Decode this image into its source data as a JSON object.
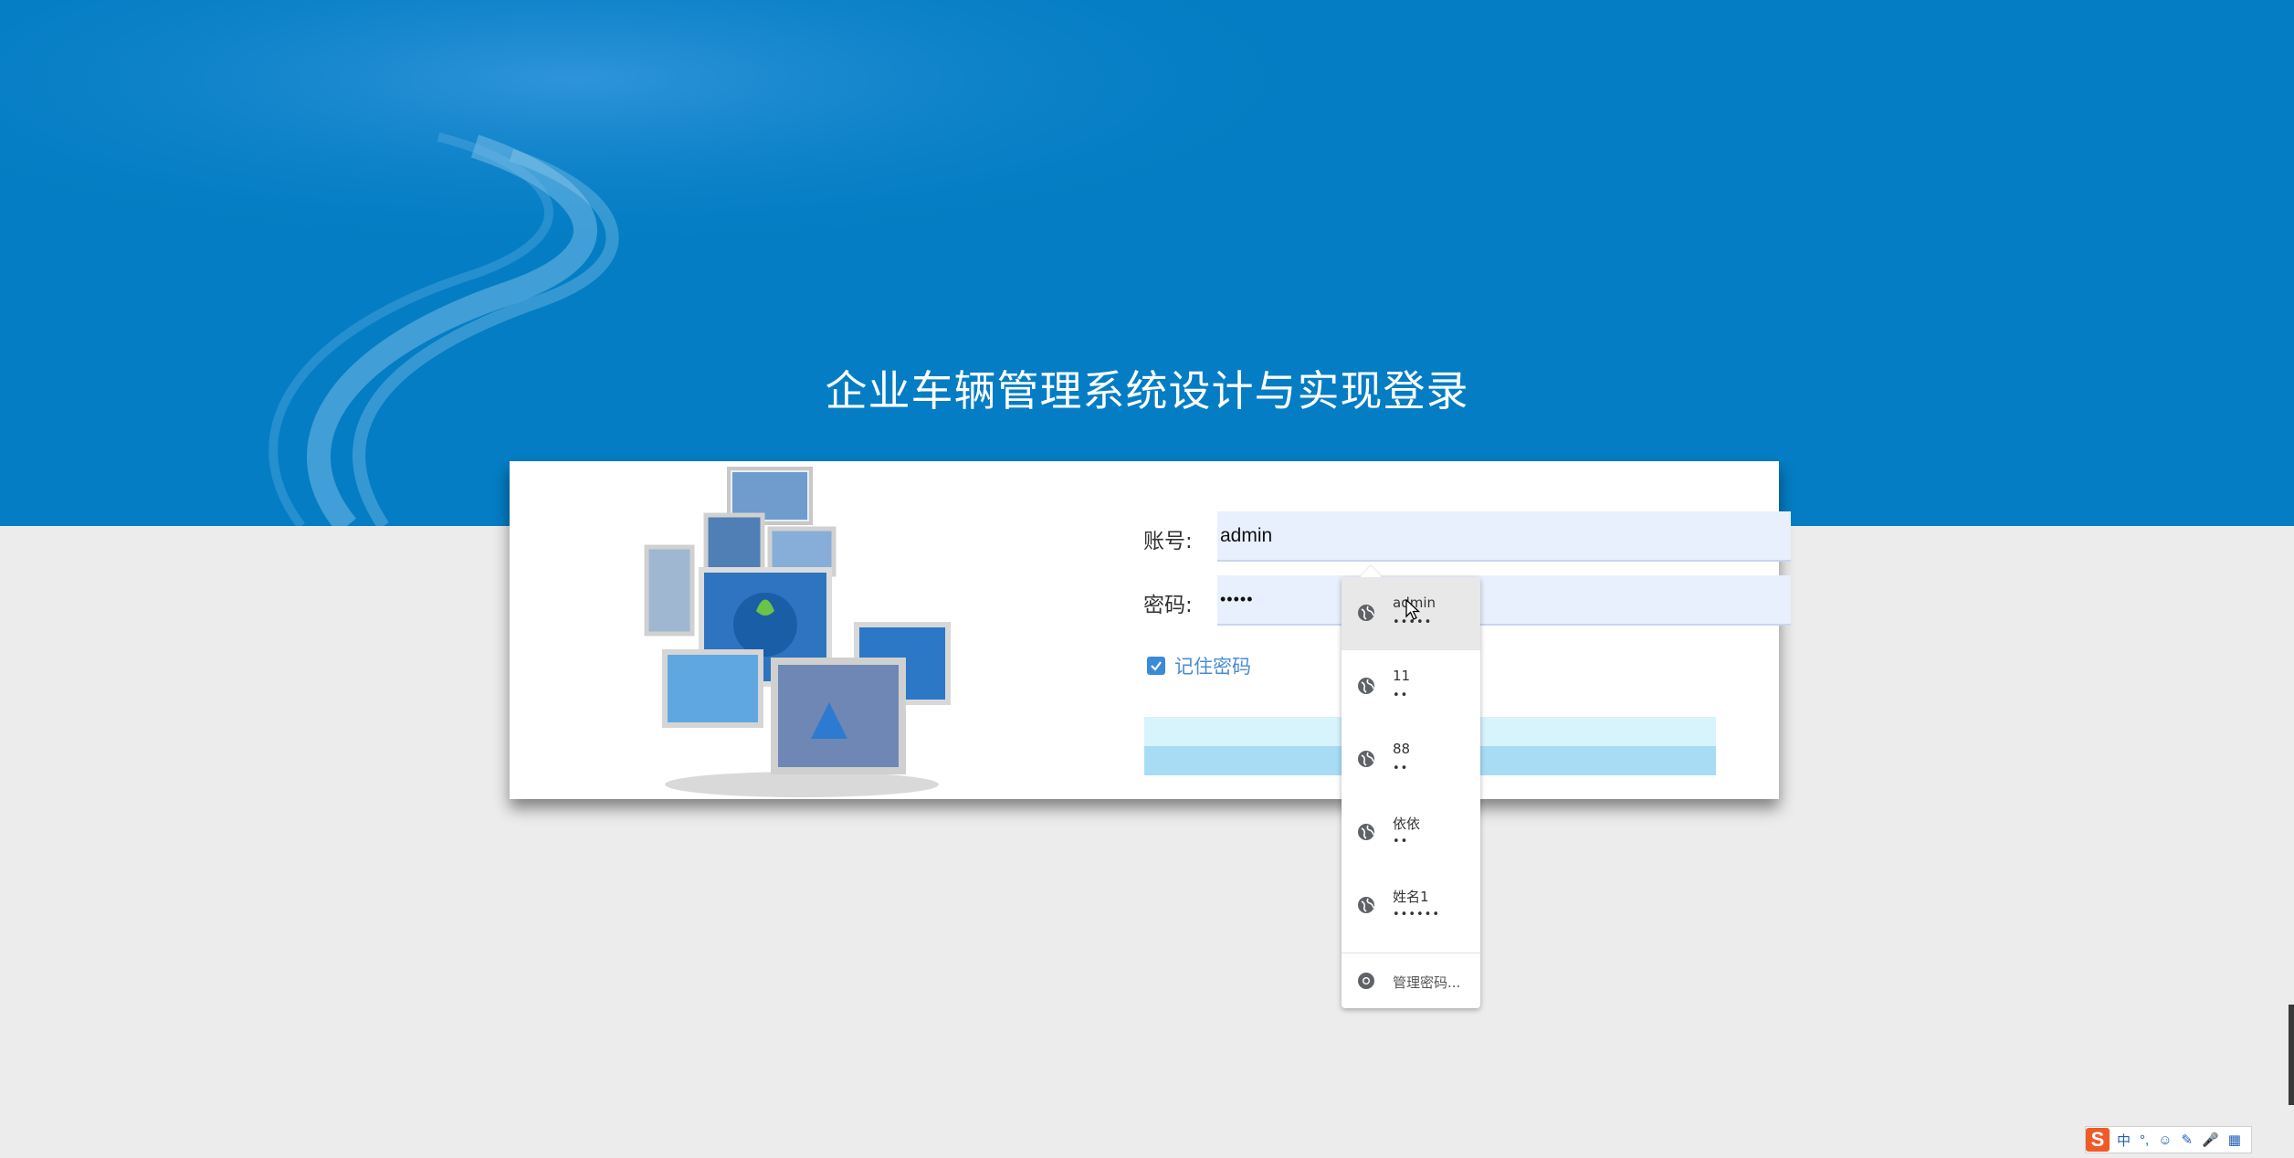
{
  "page": {
    "title": "企业车辆管理系统设计与实现登录"
  },
  "form": {
    "account_label": "账号:",
    "account_value": "admin",
    "password_label": "密码:",
    "password_masked": "•••••",
    "remember_label": "记住密码",
    "remember_checked": true
  },
  "autofill": {
    "items": [
      {
        "user": "admin",
        "mask": "•••••"
      },
      {
        "user": "11",
        "mask": "••"
      },
      {
        "user": "88",
        "mask": "••"
      },
      {
        "user": "依依",
        "mask": "••"
      },
      {
        "user": "姓名1",
        "mask": "••••••"
      }
    ],
    "manage_label": "管理密码..."
  },
  "ime": {
    "logo": "S",
    "items": [
      "中",
      "°,",
      "☺",
      "✎",
      "🎤",
      "▦"
    ]
  },
  "colors": {
    "banner": "#047dc4",
    "page_bg": "#ececec",
    "input_bg": "#e8f0fe",
    "checkbox": "#3b8ad8",
    "button_top": "#d7f3fc",
    "button_bottom": "#a8dcf5"
  }
}
